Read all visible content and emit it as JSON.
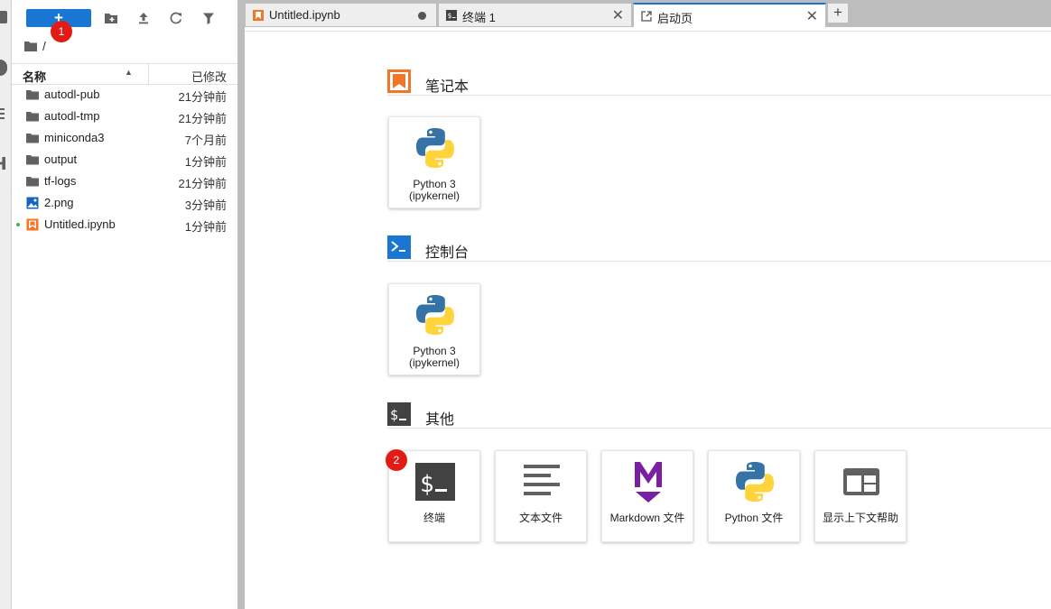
{
  "toolbar": {
    "new_launcher_label": "+",
    "badge1": "1"
  },
  "breadcrumb": {
    "path": "/"
  },
  "file_list": {
    "header_name": "名称",
    "header_modified": "已修改",
    "items": [
      {
        "name": "autodl-pub",
        "modified": "21分钟前",
        "type": "folder"
      },
      {
        "name": "autodl-tmp",
        "modified": "21分钟前",
        "type": "folder"
      },
      {
        "name": "miniconda3",
        "modified": "7个月前",
        "type": "folder"
      },
      {
        "name": "output",
        "modified": "1分钟前",
        "type": "folder"
      },
      {
        "name": "tf-logs",
        "modified": "21分钟前",
        "type": "folder"
      },
      {
        "name": "2.png",
        "modified": "3分钟前",
        "type": "image"
      },
      {
        "name": "Untitled.ipynb",
        "modified": "1分钟前",
        "type": "notebook",
        "running": true
      }
    ]
  },
  "tabs": [
    {
      "label": "Untitled.ipynb",
      "icon": "notebook-icon",
      "dirty": true
    },
    {
      "label": "终端 1",
      "icon": "terminal-icon"
    },
    {
      "label": "启动页",
      "icon": "launcher-icon",
      "active": true
    }
  ],
  "add_tab_label": "+",
  "launcher": {
    "sections": {
      "notebook": {
        "title": "笔记本",
        "cards": [
          {
            "label_line1": "Python 3",
            "label_line2": "(ipykernel)"
          }
        ]
      },
      "console": {
        "title": "控制台",
        "cards": [
          {
            "label_line1": "Python 3",
            "label_line2": "(ipykernel)"
          }
        ]
      },
      "other": {
        "title": "其他",
        "badge": "2",
        "cards": [
          {
            "label": "终端"
          },
          {
            "label": "文本文件"
          },
          {
            "label": "Markdown 文件"
          },
          {
            "label": "Python 文件"
          },
          {
            "label": "显示上下文帮助"
          }
        ]
      }
    }
  },
  "colors": {
    "accent": "#1976d2",
    "badge": "#e21b16",
    "notebook_orange": "#f37626",
    "markdown_purple": "#7b1fa2",
    "dark_icon": "#424242"
  }
}
